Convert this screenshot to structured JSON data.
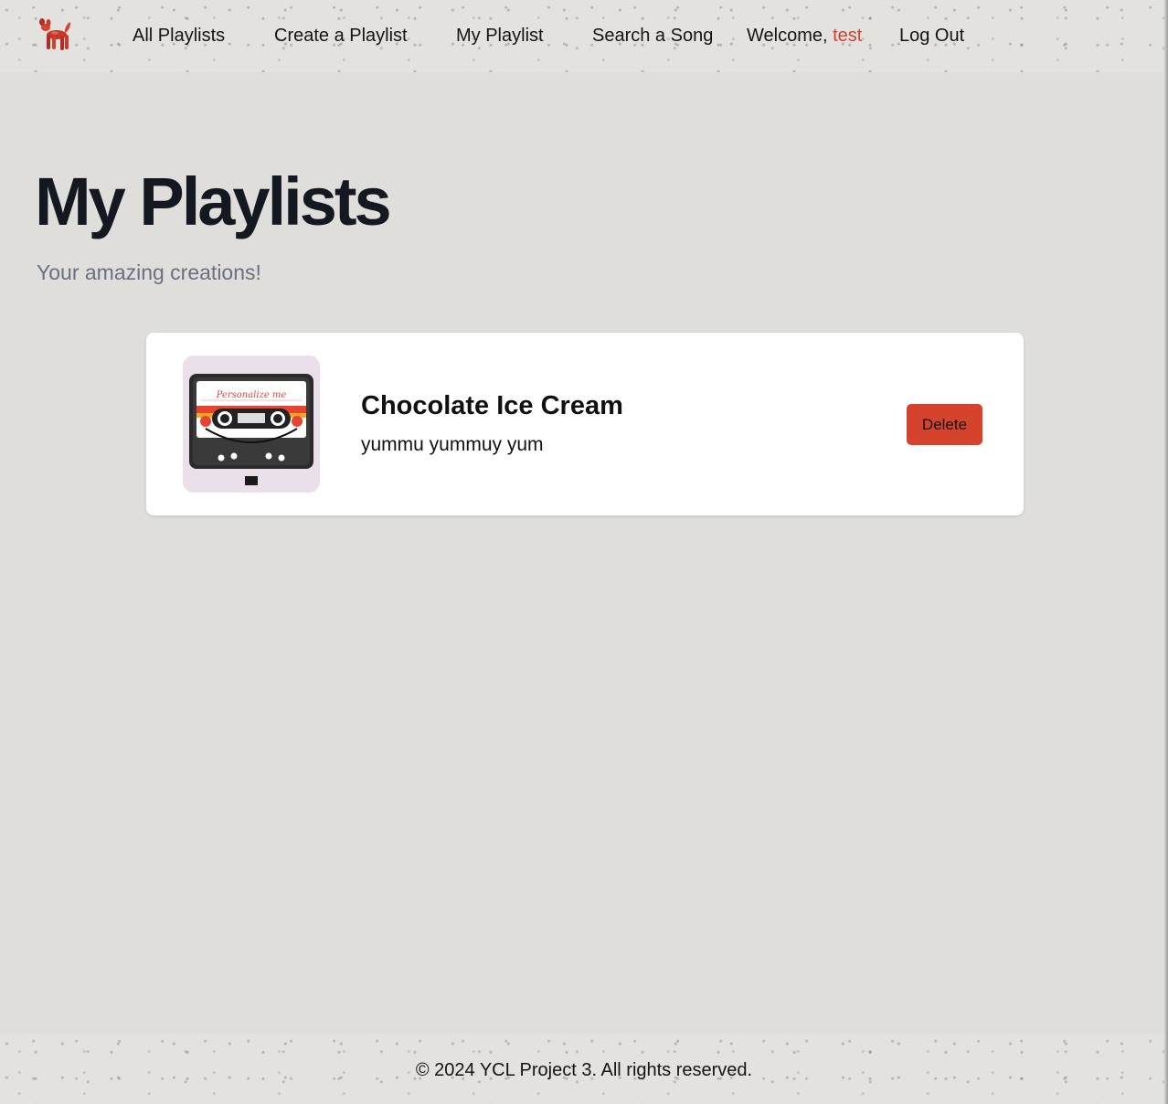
{
  "header": {
    "logo_icon": "balloon-dog-icon",
    "nav": [
      {
        "label": "All Playlists"
      },
      {
        "label": "Create a Playlist"
      },
      {
        "label": "My Playlist"
      },
      {
        "label": "Search a Song"
      }
    ],
    "welcome_label": "Welcome,",
    "username": "test",
    "logout_label": "Log Out"
  },
  "main": {
    "title": "My Playlists",
    "subtitle": "Your amazing creations!",
    "playlists": [
      {
        "cover_text": "Personalize me",
        "title": "Chocolate Ice Cream",
        "description": "yummu yummuy yum",
        "delete_label": "Delete"
      }
    ]
  },
  "footer": {
    "text": "© 2024 YCL Project 3. All rights reserved."
  },
  "colors": {
    "accent": "#d6432c",
    "username": "#d2412b",
    "background": "#dfdeda",
    "title": "#141821",
    "subtitle": "#6b7080"
  }
}
